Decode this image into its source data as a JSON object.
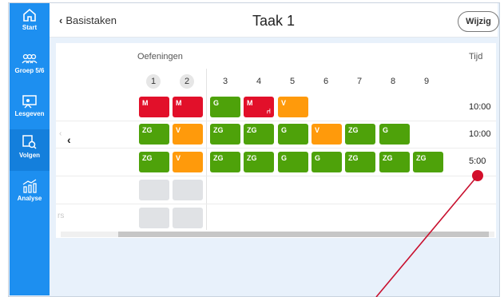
{
  "sidebar": {
    "items": [
      {
        "label": "Start",
        "icon": "home-icon"
      },
      {
        "label": "Groep 5/6",
        "icon": "group-icon"
      },
      {
        "label": "Lesgeven",
        "icon": "board-icon"
      },
      {
        "label": "Volgen",
        "icon": "follow-icon",
        "active": true
      },
      {
        "label": "Analyse",
        "icon": "analytics-icon"
      }
    ]
  },
  "header": {
    "back_label": "Basistaken",
    "title": "Taak 1",
    "edit_label": "Wijzig"
  },
  "table": {
    "section_label": "Oefeningen",
    "time_header": "Tijd",
    "columns": [
      "1",
      "2",
      "3",
      "4",
      "5",
      "6",
      "7",
      "8",
      "9"
    ],
    "rows": [
      {
        "cells": [
          "M",
          "M",
          "G",
          "M",
          "V",
          "",
          "",
          "",
          ""
        ],
        "time": "10:00"
      },
      {
        "cells": [
          "ZG",
          "V",
          "ZG",
          "ZG",
          "G",
          "V",
          "ZG",
          "G",
          ""
        ],
        "time": "10:00"
      },
      {
        "cells": [
          "ZG",
          "V",
          "ZG",
          "ZG",
          "G",
          "G",
          "ZG",
          "ZG",
          "ZG"
        ],
        "time": "5:00"
      }
    ],
    "faint_text": "rs"
  },
  "colors": {
    "M": "#e2102a",
    "G": "#4ea20a",
    "ZG": "#4ea20a",
    "V": "#ff9a0b",
    "sidebar": "#1d8ff0"
  }
}
